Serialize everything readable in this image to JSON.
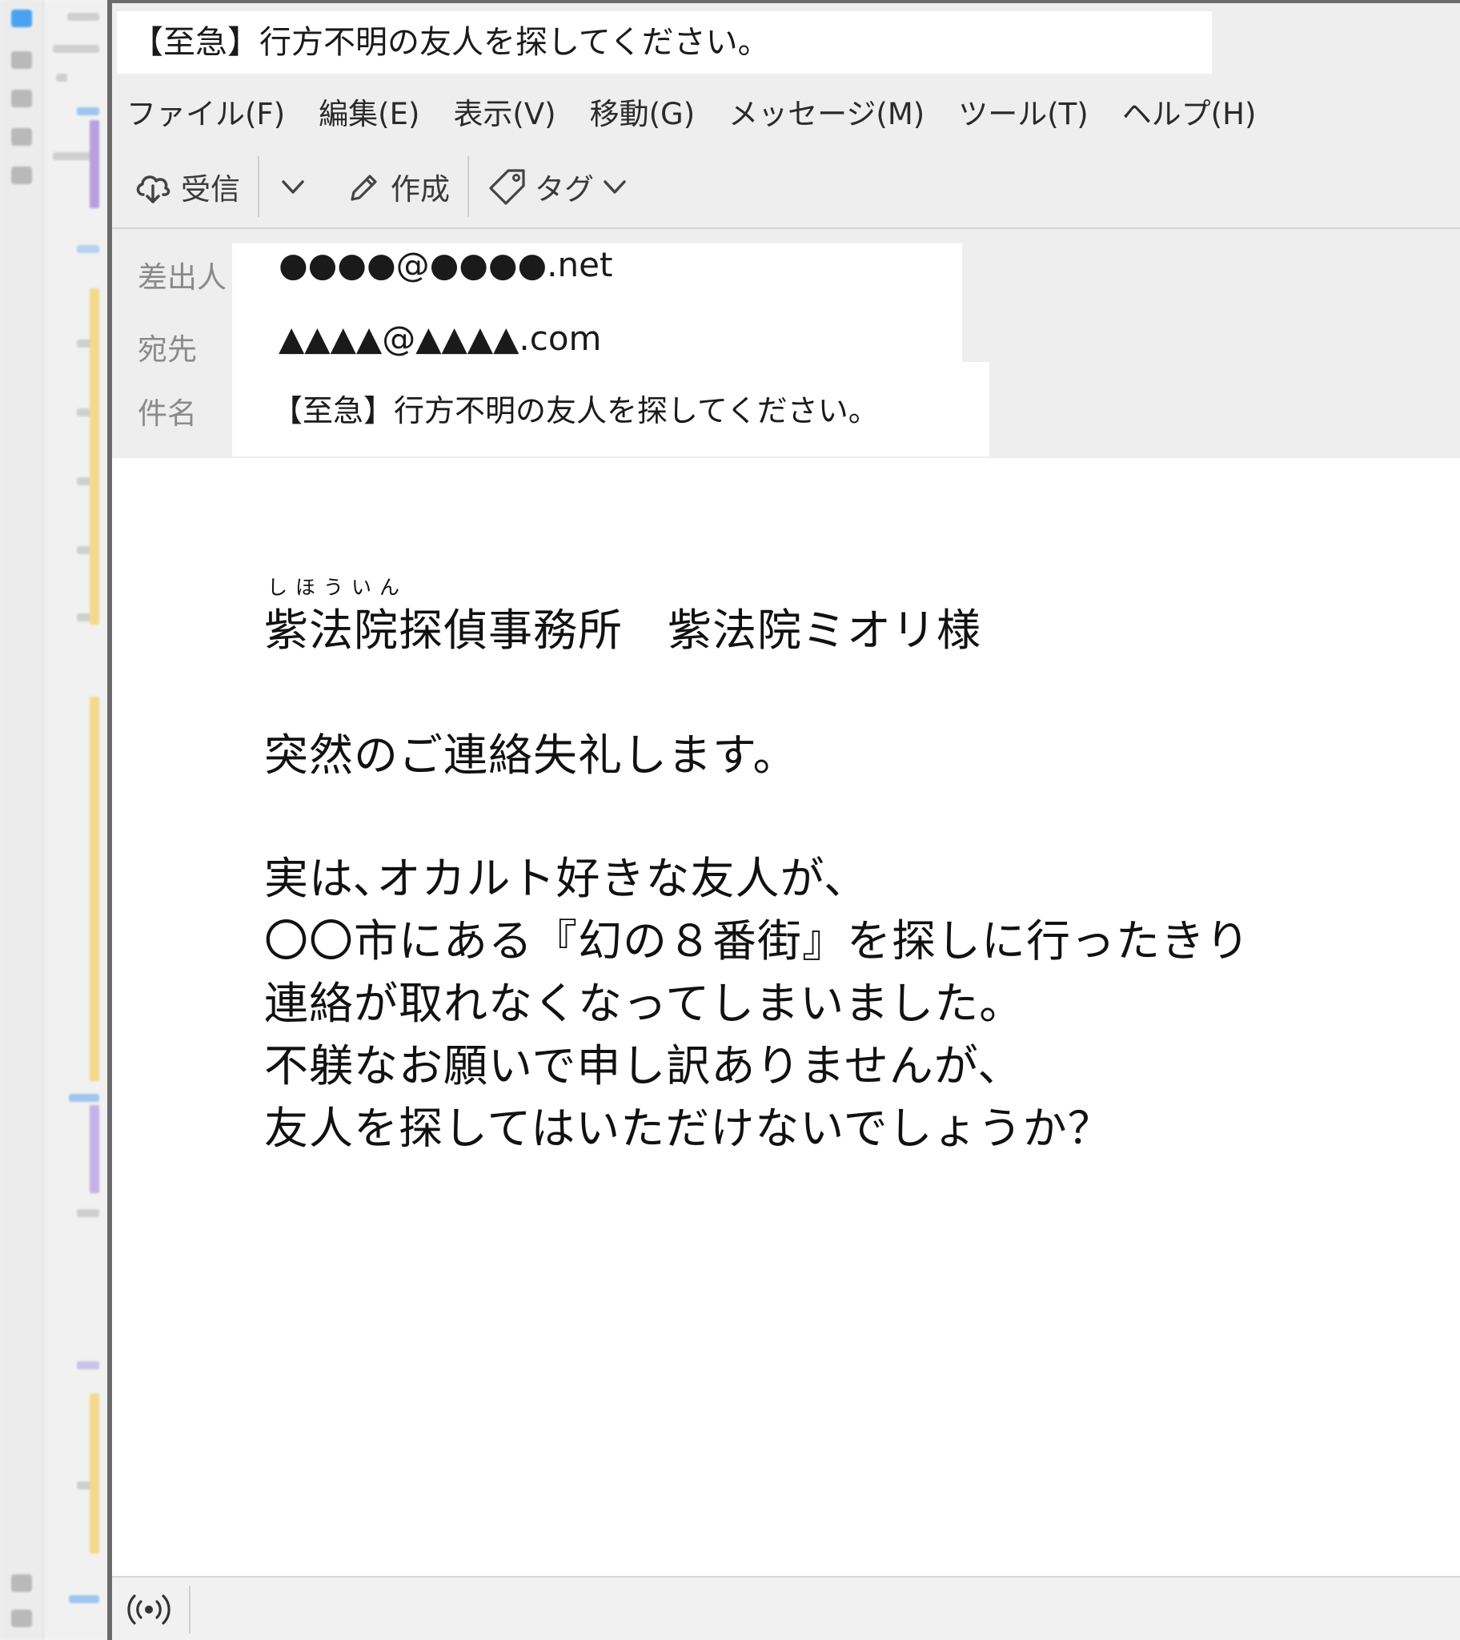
{
  "window": {
    "title": "【至急】行方不明の友人を探してください。"
  },
  "menu": {
    "items": [
      {
        "label": "ファイル(F)"
      },
      {
        "label": "編集(E)"
      },
      {
        "label": "表示(V)"
      },
      {
        "label": "移動(G)"
      },
      {
        "label": "メッセージ(M)"
      },
      {
        "label": "ツール(T)"
      },
      {
        "label": "ヘルプ(H)"
      }
    ]
  },
  "toolbar": {
    "receive_label": "受信",
    "compose_label": "作成",
    "tag_label": "タグ"
  },
  "header": {
    "from_label": "差出人",
    "from_value": "●●●●@●●●●.net",
    "to_label": "宛先",
    "to_value": "▲▲▲▲@▲▲▲▲.com",
    "subject_label": "件名",
    "subject_value": "【至急】行方不明の友人を探してください。"
  },
  "body": {
    "ruby": "しほういん",
    "addressee": "紫法院探偵事務所　紫法院ミオリ様",
    "greeting": "突然のご連絡失礼します。",
    "lines": [
      "実は､オカルト好きな友人が､",
      "〇〇市にある『幻の８番街』を探しに行ったきり",
      "連絡が取れなくなってしまいました。",
      "不躾なお願いで申し訳ありませんが､",
      "友人を探してはいただけないでしょうか？"
    ]
  },
  "icons": {
    "receive": "cloud-download-icon",
    "dropdown": "chevron-down-icon",
    "compose": "pencil-icon",
    "tag": "tag-icon",
    "status": "wireless-signal-icon"
  }
}
